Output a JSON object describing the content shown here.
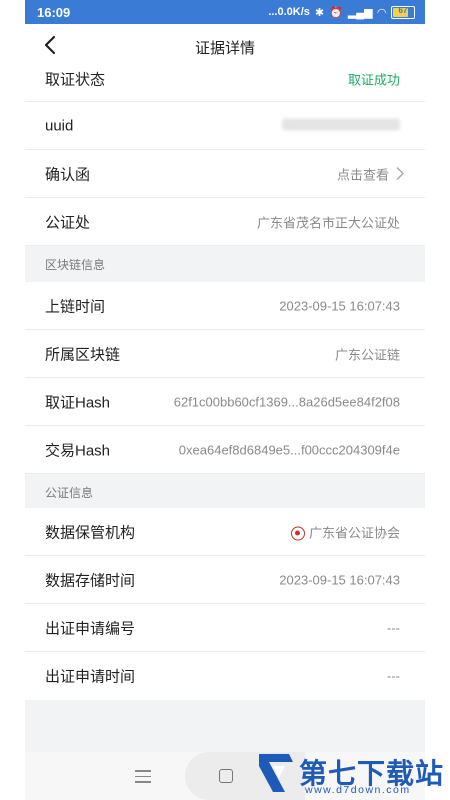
{
  "status_bar": {
    "time": "16:09",
    "network_speed": "...0.0K/s",
    "battery": "67"
  },
  "header": {
    "title": "证据详情"
  },
  "rows_top": [
    {
      "label": "取证状态",
      "value": "取证成功",
      "value_color": "#1aad63"
    },
    {
      "label": "uuid",
      "value": ""
    },
    {
      "label": "确认函",
      "value": "点击查看"
    },
    {
      "label": "公证处",
      "value": "广东省茂名市正大公证处"
    }
  ],
  "section_blockchain": {
    "title": "区块链信息"
  },
  "rows_blockchain": [
    {
      "label": "上链时间",
      "value": "2023-09-15 16:07:43"
    },
    {
      "label": "所属区块链",
      "value": "广东公证链"
    },
    {
      "label": "取证Hash",
      "value": "62f1c00bb60cf1369...8a26d5ee84f2f08"
    },
    {
      "label": "交易Hash",
      "value": "0xea64ef8d6849e5...f00ccc204309f4e"
    }
  ],
  "section_notary": {
    "title": "公证信息"
  },
  "rows_notary": [
    {
      "label": "数据保管机构",
      "value": "广东省公证协会"
    },
    {
      "label": "数据存储时间",
      "value": "2023-09-15 16:07:43"
    },
    {
      "label": "出证申请编号",
      "value": "---"
    },
    {
      "label": "出证申请时间",
      "value": "---"
    }
  ],
  "watermark": {
    "name": "第七下载站",
    "url": "www.d7down.com"
  },
  "colors": {
    "status_bar": "#3a7bd5",
    "success_green": "#1aad63",
    "brand_blue": "#1e5bb8"
  }
}
